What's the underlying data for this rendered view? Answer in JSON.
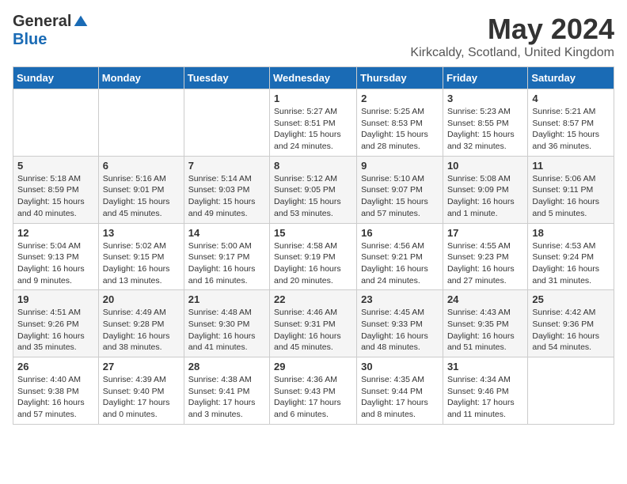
{
  "header": {
    "logo_general": "General",
    "logo_blue": "Blue",
    "month_title": "May 2024",
    "location": "Kirkcaldy, Scotland, United Kingdom"
  },
  "days_of_week": [
    "Sunday",
    "Monday",
    "Tuesday",
    "Wednesday",
    "Thursday",
    "Friday",
    "Saturday"
  ],
  "weeks": [
    [
      {
        "day": "",
        "info": ""
      },
      {
        "day": "",
        "info": ""
      },
      {
        "day": "",
        "info": ""
      },
      {
        "day": "1",
        "info": "Sunrise: 5:27 AM\nSunset: 8:51 PM\nDaylight: 15 hours\nand 24 minutes."
      },
      {
        "day": "2",
        "info": "Sunrise: 5:25 AM\nSunset: 8:53 PM\nDaylight: 15 hours\nand 28 minutes."
      },
      {
        "day": "3",
        "info": "Sunrise: 5:23 AM\nSunset: 8:55 PM\nDaylight: 15 hours\nand 32 minutes."
      },
      {
        "day": "4",
        "info": "Sunrise: 5:21 AM\nSunset: 8:57 PM\nDaylight: 15 hours\nand 36 minutes."
      }
    ],
    [
      {
        "day": "5",
        "info": "Sunrise: 5:18 AM\nSunset: 8:59 PM\nDaylight: 15 hours\nand 40 minutes."
      },
      {
        "day": "6",
        "info": "Sunrise: 5:16 AM\nSunset: 9:01 PM\nDaylight: 15 hours\nand 45 minutes."
      },
      {
        "day": "7",
        "info": "Sunrise: 5:14 AM\nSunset: 9:03 PM\nDaylight: 15 hours\nand 49 minutes."
      },
      {
        "day": "8",
        "info": "Sunrise: 5:12 AM\nSunset: 9:05 PM\nDaylight: 15 hours\nand 53 minutes."
      },
      {
        "day": "9",
        "info": "Sunrise: 5:10 AM\nSunset: 9:07 PM\nDaylight: 15 hours\nand 57 minutes."
      },
      {
        "day": "10",
        "info": "Sunrise: 5:08 AM\nSunset: 9:09 PM\nDaylight: 16 hours\nand 1 minute."
      },
      {
        "day": "11",
        "info": "Sunrise: 5:06 AM\nSunset: 9:11 PM\nDaylight: 16 hours\nand 5 minutes."
      }
    ],
    [
      {
        "day": "12",
        "info": "Sunrise: 5:04 AM\nSunset: 9:13 PM\nDaylight: 16 hours\nand 9 minutes."
      },
      {
        "day": "13",
        "info": "Sunrise: 5:02 AM\nSunset: 9:15 PM\nDaylight: 16 hours\nand 13 minutes."
      },
      {
        "day": "14",
        "info": "Sunrise: 5:00 AM\nSunset: 9:17 PM\nDaylight: 16 hours\nand 16 minutes."
      },
      {
        "day": "15",
        "info": "Sunrise: 4:58 AM\nSunset: 9:19 PM\nDaylight: 16 hours\nand 20 minutes."
      },
      {
        "day": "16",
        "info": "Sunrise: 4:56 AM\nSunset: 9:21 PM\nDaylight: 16 hours\nand 24 minutes."
      },
      {
        "day": "17",
        "info": "Sunrise: 4:55 AM\nSunset: 9:23 PM\nDaylight: 16 hours\nand 27 minutes."
      },
      {
        "day": "18",
        "info": "Sunrise: 4:53 AM\nSunset: 9:24 PM\nDaylight: 16 hours\nand 31 minutes."
      }
    ],
    [
      {
        "day": "19",
        "info": "Sunrise: 4:51 AM\nSunset: 9:26 PM\nDaylight: 16 hours\nand 35 minutes."
      },
      {
        "day": "20",
        "info": "Sunrise: 4:49 AM\nSunset: 9:28 PM\nDaylight: 16 hours\nand 38 minutes."
      },
      {
        "day": "21",
        "info": "Sunrise: 4:48 AM\nSunset: 9:30 PM\nDaylight: 16 hours\nand 41 minutes."
      },
      {
        "day": "22",
        "info": "Sunrise: 4:46 AM\nSunset: 9:31 PM\nDaylight: 16 hours\nand 45 minutes."
      },
      {
        "day": "23",
        "info": "Sunrise: 4:45 AM\nSunset: 9:33 PM\nDaylight: 16 hours\nand 48 minutes."
      },
      {
        "day": "24",
        "info": "Sunrise: 4:43 AM\nSunset: 9:35 PM\nDaylight: 16 hours\nand 51 minutes."
      },
      {
        "day": "25",
        "info": "Sunrise: 4:42 AM\nSunset: 9:36 PM\nDaylight: 16 hours\nand 54 minutes."
      }
    ],
    [
      {
        "day": "26",
        "info": "Sunrise: 4:40 AM\nSunset: 9:38 PM\nDaylight: 16 hours\nand 57 minutes."
      },
      {
        "day": "27",
        "info": "Sunrise: 4:39 AM\nSunset: 9:40 PM\nDaylight: 17 hours\nand 0 minutes."
      },
      {
        "day": "28",
        "info": "Sunrise: 4:38 AM\nSunset: 9:41 PM\nDaylight: 17 hours\nand 3 minutes."
      },
      {
        "day": "29",
        "info": "Sunrise: 4:36 AM\nSunset: 9:43 PM\nDaylight: 17 hours\nand 6 minutes."
      },
      {
        "day": "30",
        "info": "Sunrise: 4:35 AM\nSunset: 9:44 PM\nDaylight: 17 hours\nand 8 minutes."
      },
      {
        "day": "31",
        "info": "Sunrise: 4:34 AM\nSunset: 9:46 PM\nDaylight: 17 hours\nand 11 minutes."
      },
      {
        "day": "",
        "info": ""
      }
    ]
  ]
}
